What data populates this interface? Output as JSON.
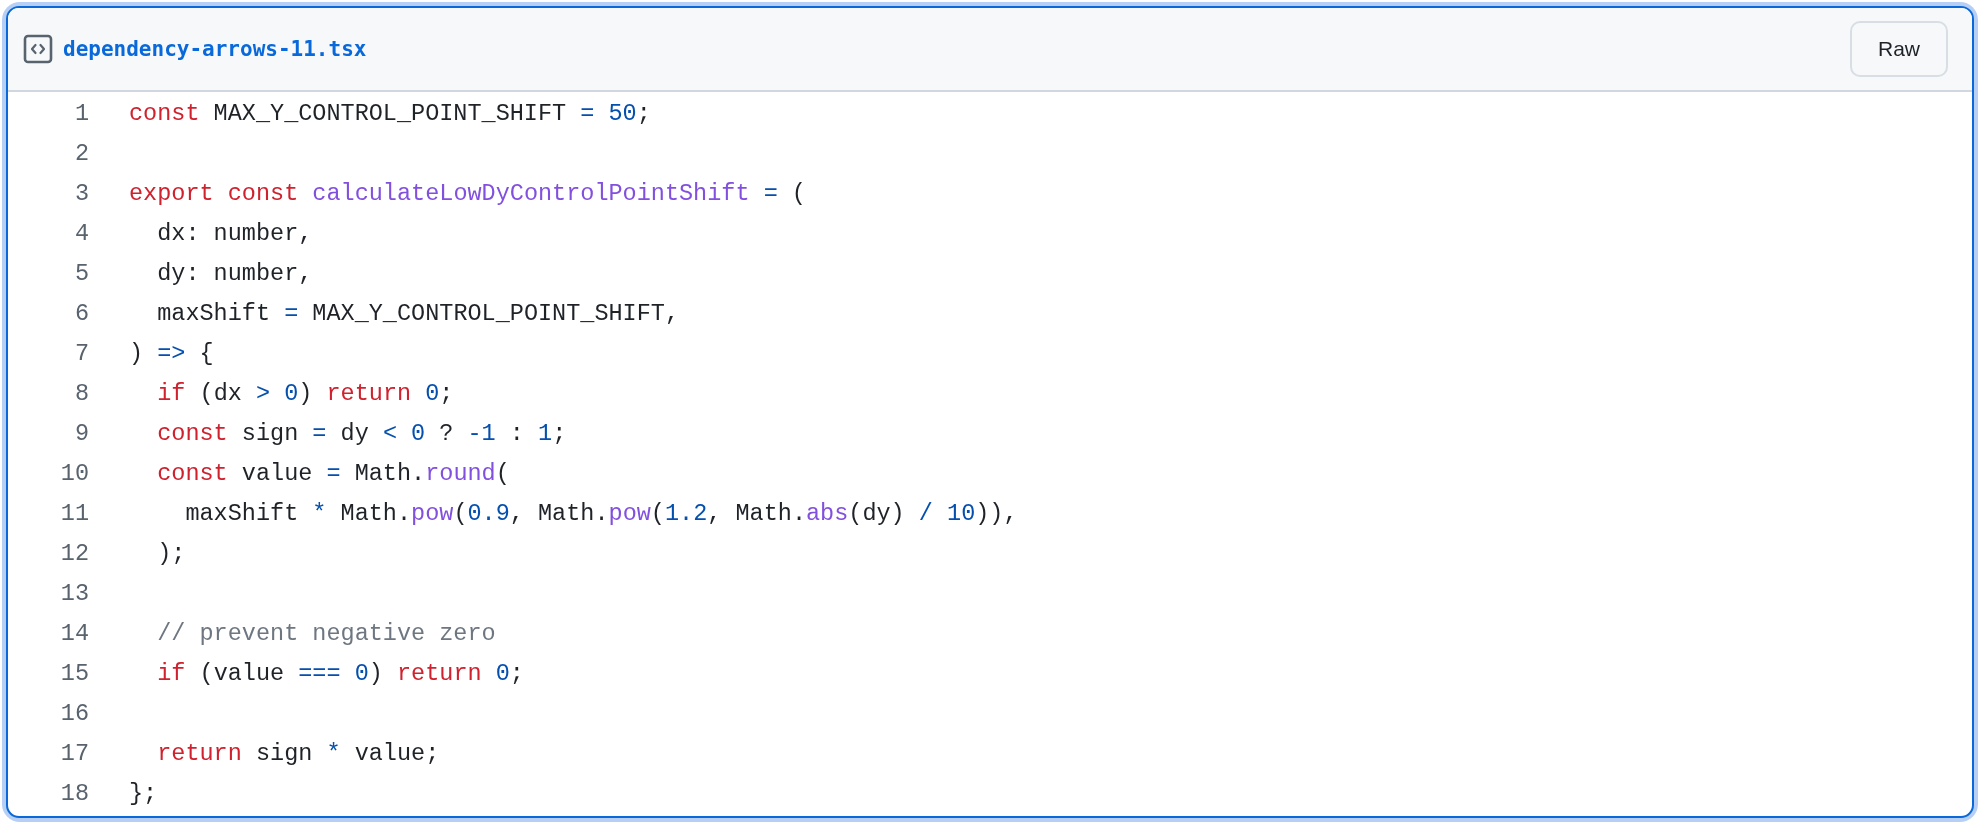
{
  "file": {
    "name": "dependency-arrows-11.tsx",
    "raw_button": "Raw"
  },
  "lines": [
    {
      "number": "1",
      "tokens": [
        {
          "kind": "keyword",
          "text": "const"
        },
        {
          "kind": "plain",
          "text": " MAX_Y_CONTROL_POINT_SHIFT "
        },
        {
          "kind": "constant",
          "text": "="
        },
        {
          "kind": "constant",
          "text": " 50"
        },
        {
          "kind": "plain",
          "text": ";"
        }
      ]
    },
    {
      "number": "2"
    },
    {
      "number": "3",
      "tokens": [
        {
          "kind": "keyword",
          "text": "export"
        },
        {
          "kind": "keyword",
          "text": " const"
        },
        {
          "kind": "function",
          "text": " calculateLowDyControlPointShift"
        },
        {
          "kind": "constant",
          "text": " ="
        },
        {
          "kind": "plain",
          "text": " ("
        }
      ]
    },
    {
      "number": "4",
      "tokens": [
        {
          "kind": "plain",
          "text": "  dx: number,"
        }
      ]
    },
    {
      "number": "5",
      "tokens": [
        {
          "kind": "plain",
          "text": "  dy: number,"
        }
      ]
    },
    {
      "number": "6",
      "tokens": [
        {
          "kind": "plain",
          "text": "  maxShift "
        },
        {
          "kind": "constant",
          "text": "="
        },
        {
          "kind": "plain",
          "text": " MAX_Y_CONTROL_POINT_SHIFT,"
        }
      ]
    },
    {
      "number": "7",
      "tokens": [
        {
          "kind": "plain",
          "text": ") "
        },
        {
          "kind": "constant",
          "text": "=>"
        },
        {
          "kind": "plain",
          "text": " {"
        }
      ]
    },
    {
      "number": "8",
      "tokens": [
        {
          "kind": "keyword",
          "text": "  if"
        },
        {
          "kind": "plain",
          "text": " (dx "
        },
        {
          "kind": "constant",
          "text": ">"
        },
        {
          "kind": "constant",
          "text": " 0"
        },
        {
          "kind": "plain",
          "text": ") "
        },
        {
          "kind": "keyword",
          "text": "return"
        },
        {
          "kind": "constant",
          "text": " 0"
        },
        {
          "kind": "plain",
          "text": ";"
        }
      ]
    },
    {
      "number": "9",
      "tokens": [
        {
          "kind": "keyword",
          "text": "  const"
        },
        {
          "kind": "plain",
          "text": " sign "
        },
        {
          "kind": "constant",
          "text": "="
        },
        {
          "kind": "plain",
          "text": " dy "
        },
        {
          "kind": "constant",
          "text": "<"
        },
        {
          "kind": "constant",
          "text": " 0"
        },
        {
          "kind": "plain",
          "text": " ? "
        },
        {
          "kind": "constant",
          "text": "-1"
        },
        {
          "kind": "plain",
          "text": " : "
        },
        {
          "kind": "constant",
          "text": "1"
        },
        {
          "kind": "plain",
          "text": ";"
        }
      ]
    },
    {
      "number": "10",
      "tokens": [
        {
          "kind": "keyword",
          "text": "  const"
        },
        {
          "kind": "plain",
          "text": " value "
        },
        {
          "kind": "constant",
          "text": "="
        },
        {
          "kind": "plain",
          "text": " Math."
        },
        {
          "kind": "function",
          "text": "round"
        },
        {
          "kind": "plain",
          "text": "("
        }
      ]
    },
    {
      "number": "11",
      "tokens": [
        {
          "kind": "plain",
          "text": "    maxShift "
        },
        {
          "kind": "constant",
          "text": "*"
        },
        {
          "kind": "plain",
          "text": " Math."
        },
        {
          "kind": "function",
          "text": "pow"
        },
        {
          "kind": "plain",
          "text": "("
        },
        {
          "kind": "constant",
          "text": "0.9"
        },
        {
          "kind": "plain",
          "text": ", Math."
        },
        {
          "kind": "function",
          "text": "pow"
        },
        {
          "kind": "plain",
          "text": "("
        },
        {
          "kind": "constant",
          "text": "1.2"
        },
        {
          "kind": "plain",
          "text": ", Math."
        },
        {
          "kind": "function",
          "text": "abs"
        },
        {
          "kind": "plain",
          "text": "(dy) "
        },
        {
          "kind": "constant",
          "text": "/"
        },
        {
          "kind": "constant",
          "text": " 10"
        },
        {
          "kind": "plain",
          "text": ")),"
        }
      ]
    },
    {
      "number": "12",
      "tokens": [
        {
          "kind": "plain",
          "text": "  );"
        }
      ]
    },
    {
      "number": "13"
    },
    {
      "number": "14",
      "tokens": [
        {
          "kind": "comment",
          "text": "  // prevent negative zero"
        }
      ]
    },
    {
      "number": "15",
      "tokens": [
        {
          "kind": "keyword",
          "text": "  if"
        },
        {
          "kind": "plain",
          "text": " (value "
        },
        {
          "kind": "constant",
          "text": "==="
        },
        {
          "kind": "constant",
          "text": " 0"
        },
        {
          "kind": "plain",
          "text": ") "
        },
        {
          "kind": "keyword",
          "text": "return"
        },
        {
          "kind": "constant",
          "text": " 0"
        },
        {
          "kind": "plain",
          "text": ";"
        }
      ]
    },
    {
      "number": "16"
    },
    {
      "number": "17",
      "tokens": [
        {
          "kind": "keyword",
          "text": "  return"
        },
        {
          "kind": "plain",
          "text": " sign "
        },
        {
          "kind": "constant",
          "text": "*"
        },
        {
          "kind": "plain",
          "text": " value;"
        }
      ]
    },
    {
      "number": "18",
      "tokens": [
        {
          "kind": "plain",
          "text": "};"
        }
      ]
    }
  ]
}
